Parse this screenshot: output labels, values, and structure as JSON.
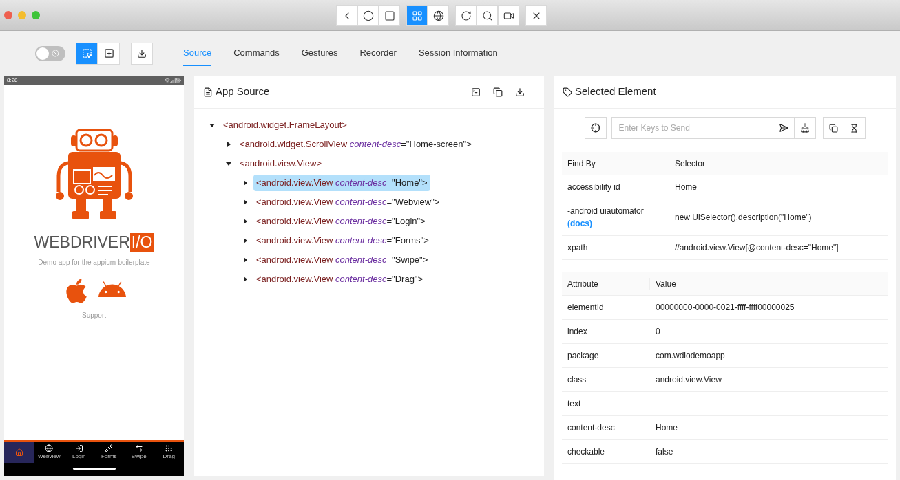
{
  "window": {
    "traffic_lights": [
      {
        "color": "#ee5f4f"
      },
      {
        "color": "#f4bd2f"
      },
      {
        "color": "#3fc43a"
      }
    ]
  },
  "top_toolbar": [
    [
      {
        "selected": false
      },
      {
        "selected": false
      },
      {
        "selected": false
      }
    ],
    [
      {
        "selected": true
      },
      {
        "selected": false
      }
    ],
    [
      {
        "selected": false
      },
      {
        "selected": false
      },
      {
        "selected": false
      }
    ],
    [
      {
        "selected": false
      }
    ]
  ],
  "toggle": {
    "on": false
  },
  "mode_buttons": [
    {
      "selected": true
    },
    {
      "selected": false
    }
  ],
  "tabs": [
    {
      "label": "Source",
      "selected": true
    },
    {
      "label": "Commands",
      "selected": false
    },
    {
      "label": "Gestures",
      "selected": false
    },
    {
      "label": "Recorder",
      "selected": false
    },
    {
      "label": "Session Information",
      "selected": false
    }
  ],
  "device": {
    "time": "8:28",
    "logo_word": "WEBDRIVER",
    "logo_badge": "I/O",
    "tagline": "Demo app for the appium-boilerplate",
    "support": "Support",
    "nav": [
      {
        "selected": true
      },
      {
        "label": "Webview",
        "selected": false
      },
      {
        "label": "Login",
        "selected": false
      },
      {
        "label": "Forms",
        "selected": false
      },
      {
        "label": "Swipe",
        "selected": false
      },
      {
        "label": "Drag",
        "selected": false
      }
    ]
  },
  "app_source": {
    "title": "App Source",
    "tree": [
      {
        "tag": "<android.widget.FrameLayout>",
        "expanded": true,
        "selected": false,
        "children": [
          {
            "tag": "<android.widget.ScrollView",
            "attr": "content-desc",
            "value": "=\"Home-screen\">",
            "expanded": false,
            "selected": false
          },
          {
            "tag": "<android.view.View>",
            "expanded": true,
            "selected": false,
            "children": [
              {
                "tag": "<android.view.View",
                "attr": "content-desc",
                "value": "=\"Home\">",
                "expanded": false,
                "selected": true
              },
              {
                "tag": "<android.view.View",
                "attr": "content-desc",
                "value": "=\"Webview\">",
                "expanded": false,
                "selected": false
              },
              {
                "tag": "<android.view.View",
                "attr": "content-desc",
                "value": "=\"Login\">",
                "expanded": false,
                "selected": false
              },
              {
                "tag": "<android.view.View",
                "attr": "content-desc",
                "value": "=\"Forms\">",
                "expanded": false,
                "selected": false
              },
              {
                "tag": "<android.view.View",
                "attr": "content-desc",
                "value": "=\"Swipe\">",
                "expanded": false,
                "selected": false
              },
              {
                "tag": "<android.view.View",
                "attr": "content-desc",
                "value": "=\"Drag\">",
                "expanded": false,
                "selected": false
              }
            ]
          }
        ]
      }
    ]
  },
  "selected_element": {
    "title": "Selected Element",
    "keys_field": {
      "placeholder": "Enter Keys to Send"
    },
    "find_by": {
      "columns": [
        "Find By",
        "Selector"
      ],
      "rows": [
        {
          "find_by": "accessibility id",
          "selector": "Home"
        },
        {
          "find_by": "-android uiautomator",
          "link": "(docs)",
          "selector": "new UiSelector().description(\"Home\")"
        },
        {
          "find_by": "xpath",
          "selector": "//android.view.View[@content-desc=\"Home\"]"
        }
      ]
    },
    "attributes": {
      "columns": [
        "Attribute",
        "Value"
      ],
      "rows": [
        {
          "name": "elementId",
          "value": "00000000-0000-0021-ffff-ffff00000025"
        },
        {
          "name": "index",
          "value": "0"
        },
        {
          "name": "package",
          "value": "com.wdiodemoapp"
        },
        {
          "name": "class",
          "value": "android.view.View"
        },
        {
          "name": "text"
        },
        {
          "name": "content-desc",
          "value": "Home"
        },
        {
          "name": "checkable",
          "value": "false"
        }
      ]
    }
  }
}
